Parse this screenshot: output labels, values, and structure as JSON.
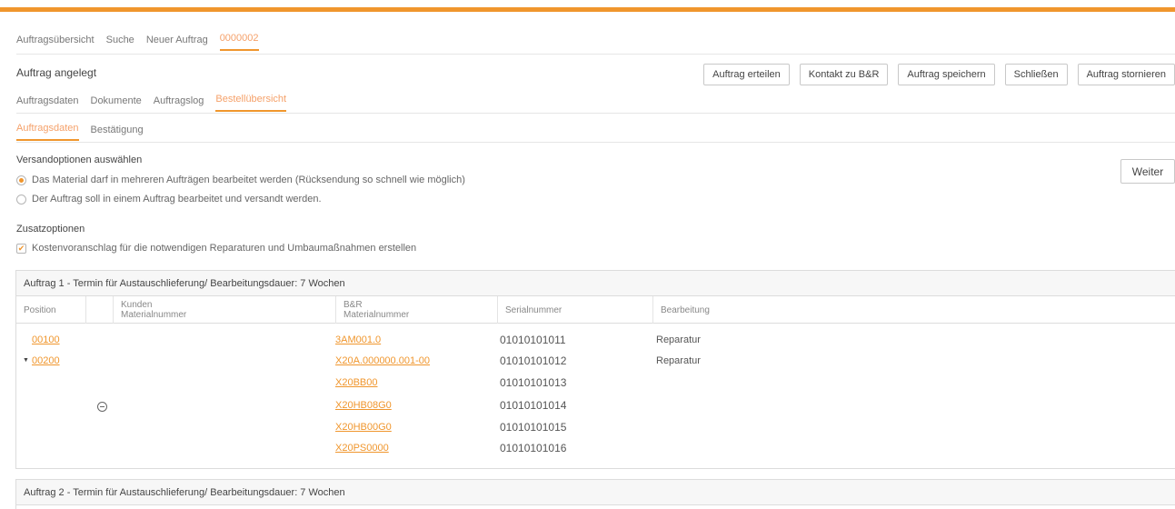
{
  "main_tabs": [
    "Auftragsübersicht",
    "Suche",
    "Neuer Auftrag",
    "0000002"
  ],
  "page_title": "Auftrag angelegt",
  "actions": [
    "Auftrag erteilen",
    "Kontakt zu B&R",
    "Auftrag speichern",
    "Schließen",
    "Auftrag stornieren"
  ],
  "sub_tabs": [
    "Auftragsdaten",
    "Dokumente",
    "Auftragslog",
    "Bestellübersicht"
  ],
  "sub2_tabs": [
    "Auftragsdaten",
    "Bestätigung"
  ],
  "shipping": {
    "title": "Versandoptionen auswählen",
    "option1": "Das Material darf in mehreren Aufträgen bearbeitet werden (Rücksendung so schnell wie möglich)",
    "option2": "Der Auftrag soll in einem Auftrag bearbeitet und versandt werden.",
    "selected": 1
  },
  "extras": {
    "title": "Zusatzoptionen",
    "option": "Kostenvoranschlag für die notwendigen Reparaturen und Umbaumaßnahmen erstellen",
    "checked": true
  },
  "weiter_label": "Weiter",
  "order1": {
    "title": "Auftrag 1 - Termin für Austauschlieferung/ Bearbeitungsdauer: 7 Wochen",
    "columns": {
      "position": "Position",
      "kunden_line1": "Kunden",
      "kunden_line2": "Materialnummer",
      "br_line1": "B&R",
      "br_line2": "Materialnummer",
      "serial": "Serialnummer",
      "bearbeitung": "Bearbeitung"
    },
    "rows": [
      {
        "position": "00100",
        "br_material": "3AM001.0",
        "serial": "01010101011",
        "bearbeitung": "Reparatur"
      },
      {
        "position": "00200",
        "br_material": "X20A.000000.001-00",
        "serial": "01010101012",
        "bearbeitung": "Reparatur"
      },
      {
        "position": "",
        "br_material": "X20BB00",
        "serial": "01010101013",
        "bearbeitung": ""
      },
      {
        "position": "",
        "br_material": "X20HB08G0",
        "serial": "01010101014",
        "bearbeitung": ""
      },
      {
        "position": "",
        "br_material": "X20HB00G0",
        "serial": "01010101015",
        "bearbeitung": ""
      },
      {
        "position": "",
        "br_material": "X20PS0000",
        "serial": "01010101016",
        "bearbeitung": ""
      }
    ]
  },
  "order2": {
    "title": "Auftrag 2 - Termin für Austauschlieferung/ Bearbeitungsdauer: 7 Wochen"
  },
  "colors": {
    "accent": "#f0962d",
    "link": "#f0962d",
    "border": "#dcdcdc"
  }
}
